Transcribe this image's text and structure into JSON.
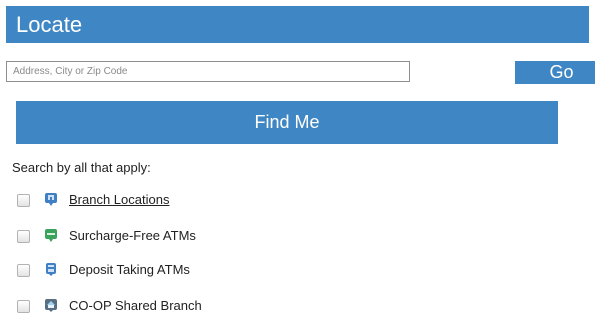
{
  "header": {
    "title": "Locate"
  },
  "search": {
    "placeholder": "Address, City or Zip Code",
    "value": ""
  },
  "go_button": {
    "label": "Go"
  },
  "find_me_button": {
    "label": "Find Me"
  },
  "filters": {
    "label": "Search by all that apply:",
    "items": [
      {
        "label": "Branch Locations",
        "icon": "branch-location-icon",
        "checked": false,
        "link": true
      },
      {
        "label": "Surcharge-Free ATMs",
        "icon": "surcharge-free-atm-icon",
        "checked": false,
        "link": false
      },
      {
        "label": "Deposit Taking ATMs",
        "icon": "deposit-atm-icon",
        "checked": false,
        "link": false
      },
      {
        "label": "CO-OP Shared Branch",
        "icon": "coop-shared-branch-icon",
        "checked": false,
        "link": false
      }
    ]
  },
  "colors": {
    "accent": "#3f86c4",
    "atm_green": "#3aa35b",
    "icon_blue": "#3f7fc4"
  }
}
